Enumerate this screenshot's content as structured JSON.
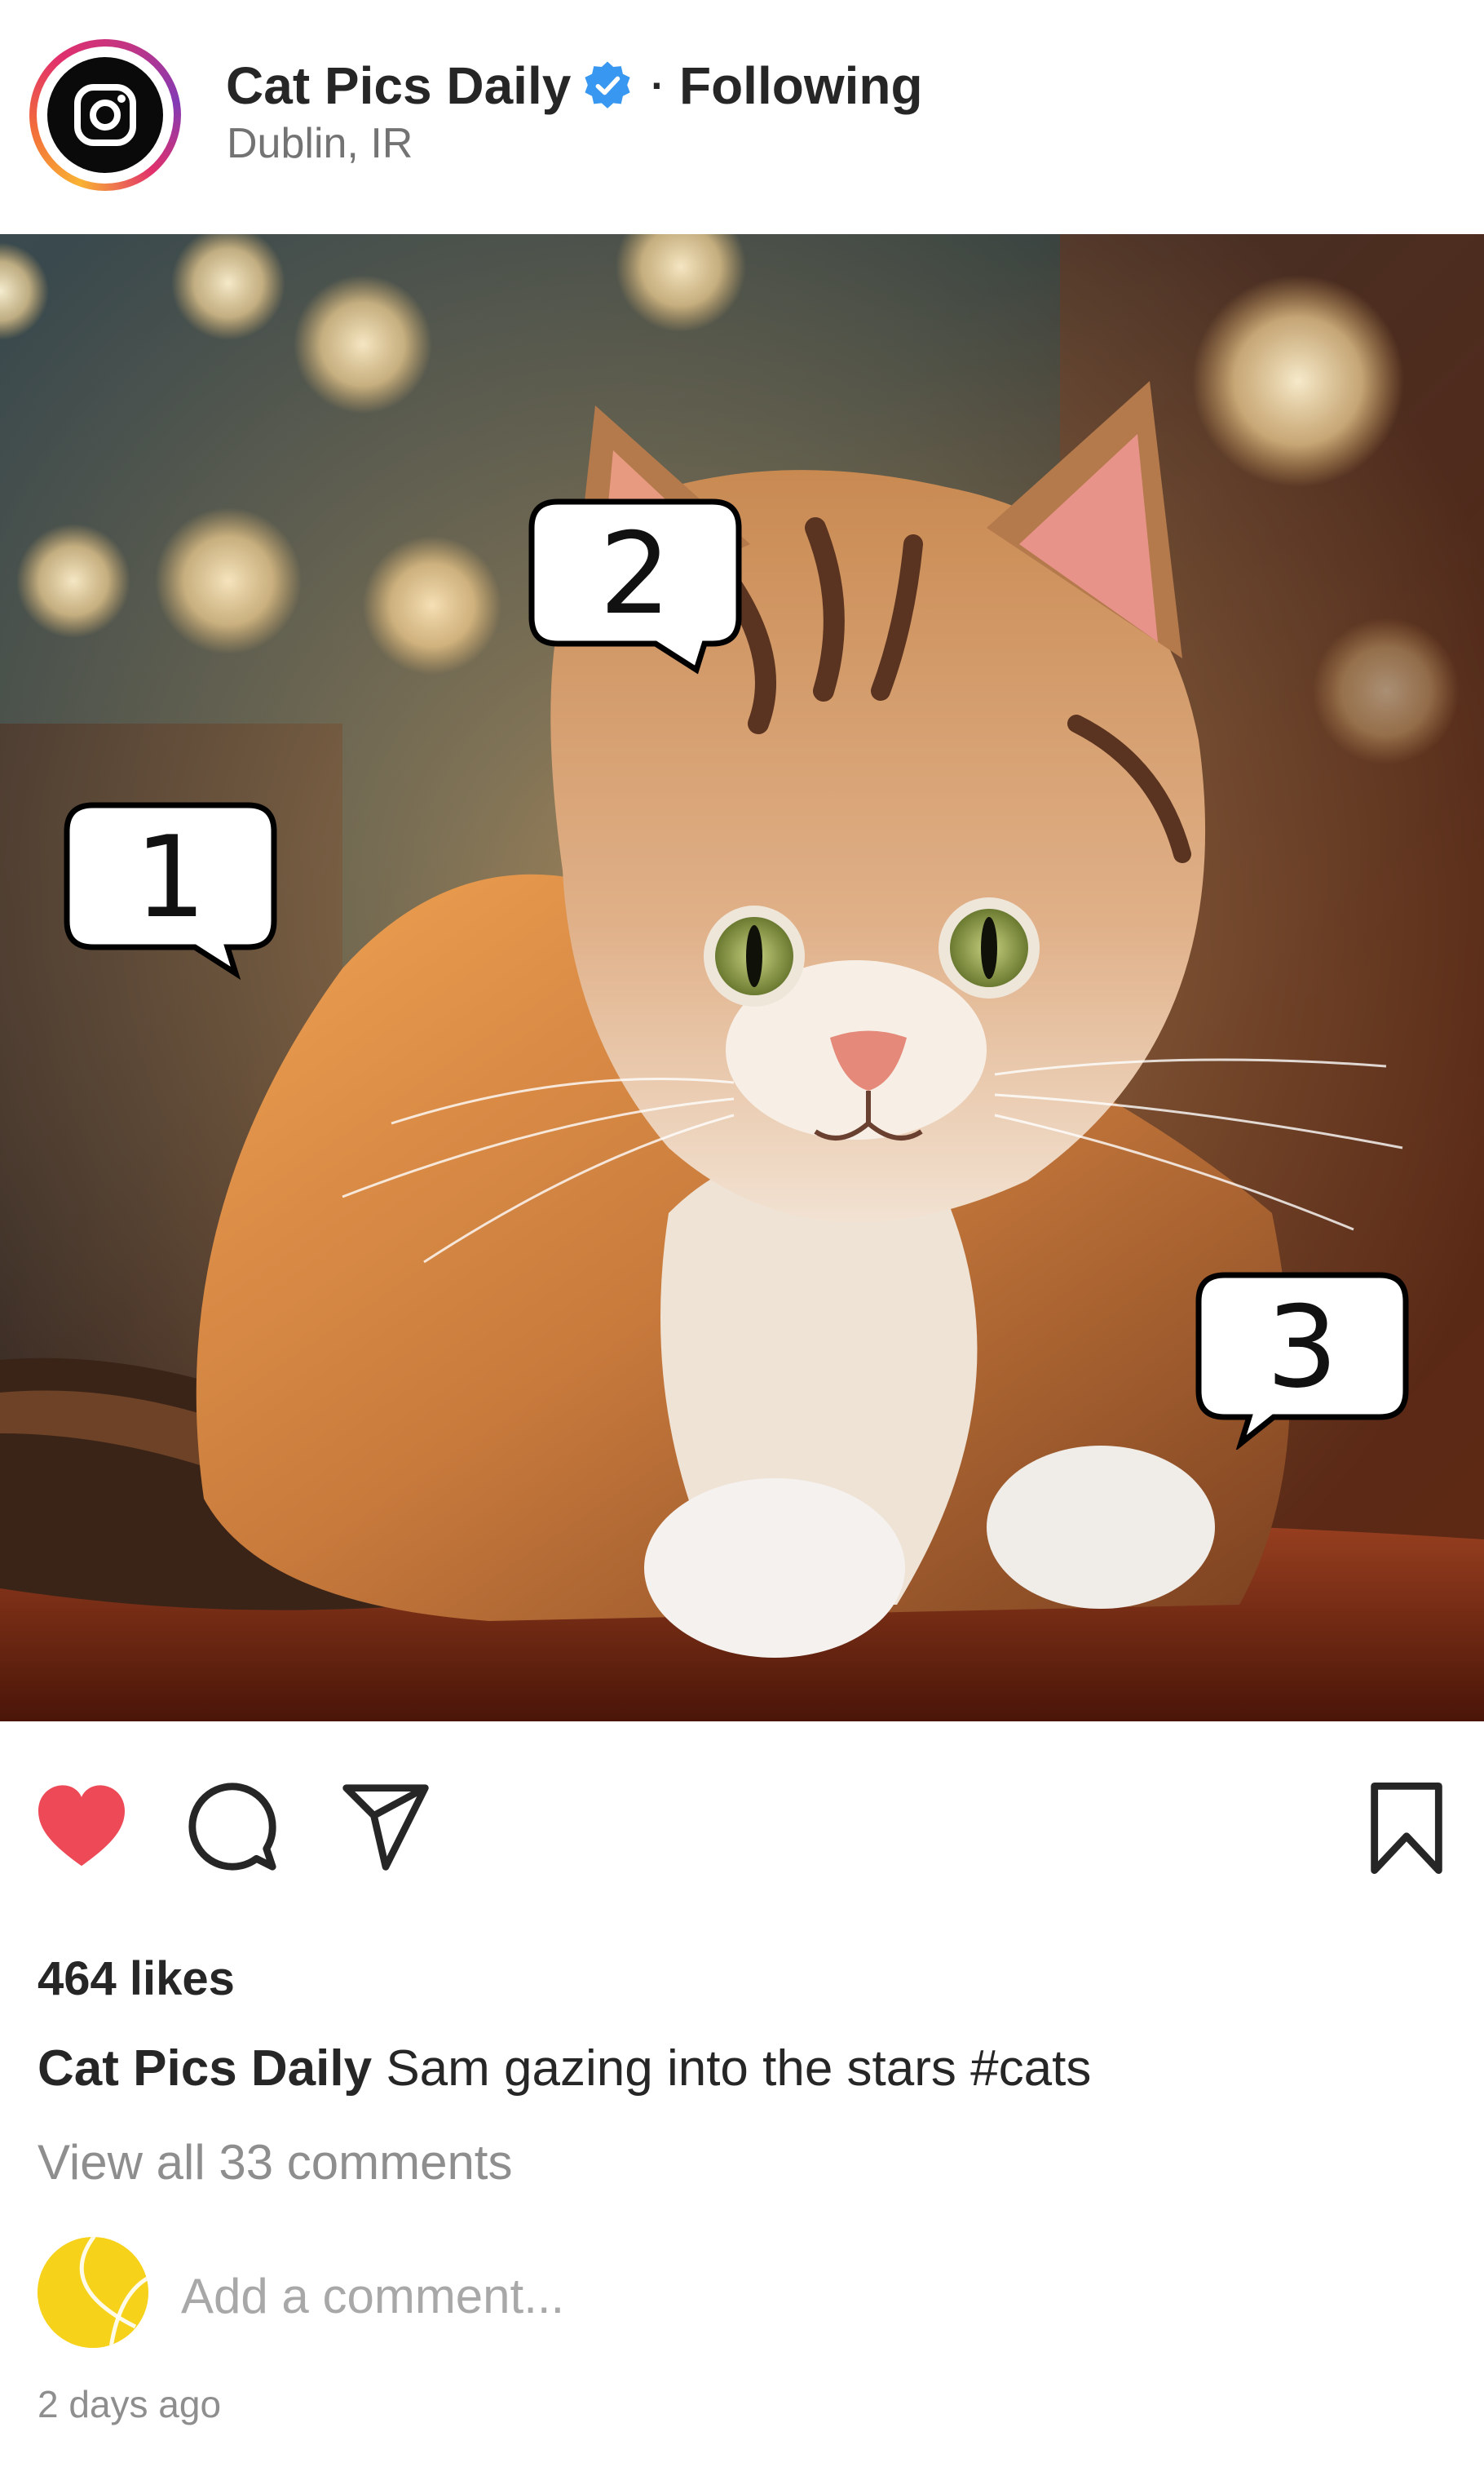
{
  "header": {
    "account_name": "Cat Pics Daily",
    "separator": "·",
    "follow_status": "Following",
    "location": "Dublin, IR"
  },
  "post": {
    "image_icon": "instagram-logo-icon",
    "callouts": [
      {
        "label": "1"
      },
      {
        "label": "2"
      },
      {
        "label": "3"
      }
    ]
  },
  "actions": {
    "like_icon": "heart-filled-icon",
    "like_color": "#ed4956",
    "comment_icon": "comment-bubble-icon",
    "share_icon": "paper-plane-icon",
    "save_icon": "bookmark-icon"
  },
  "engagement": {
    "likes": "464 likes",
    "caption_author": "Cat Pics Daily",
    "caption_text": " Sam gazing into the stars #cats",
    "view_comments": "View all 33 comments",
    "comment_placeholder": "Add a comment...",
    "timestamp": "2 days ago"
  },
  "colors": {
    "verified_badge": "#3897f0",
    "text_primary": "#262626",
    "text_secondary": "#8e8e8e"
  }
}
